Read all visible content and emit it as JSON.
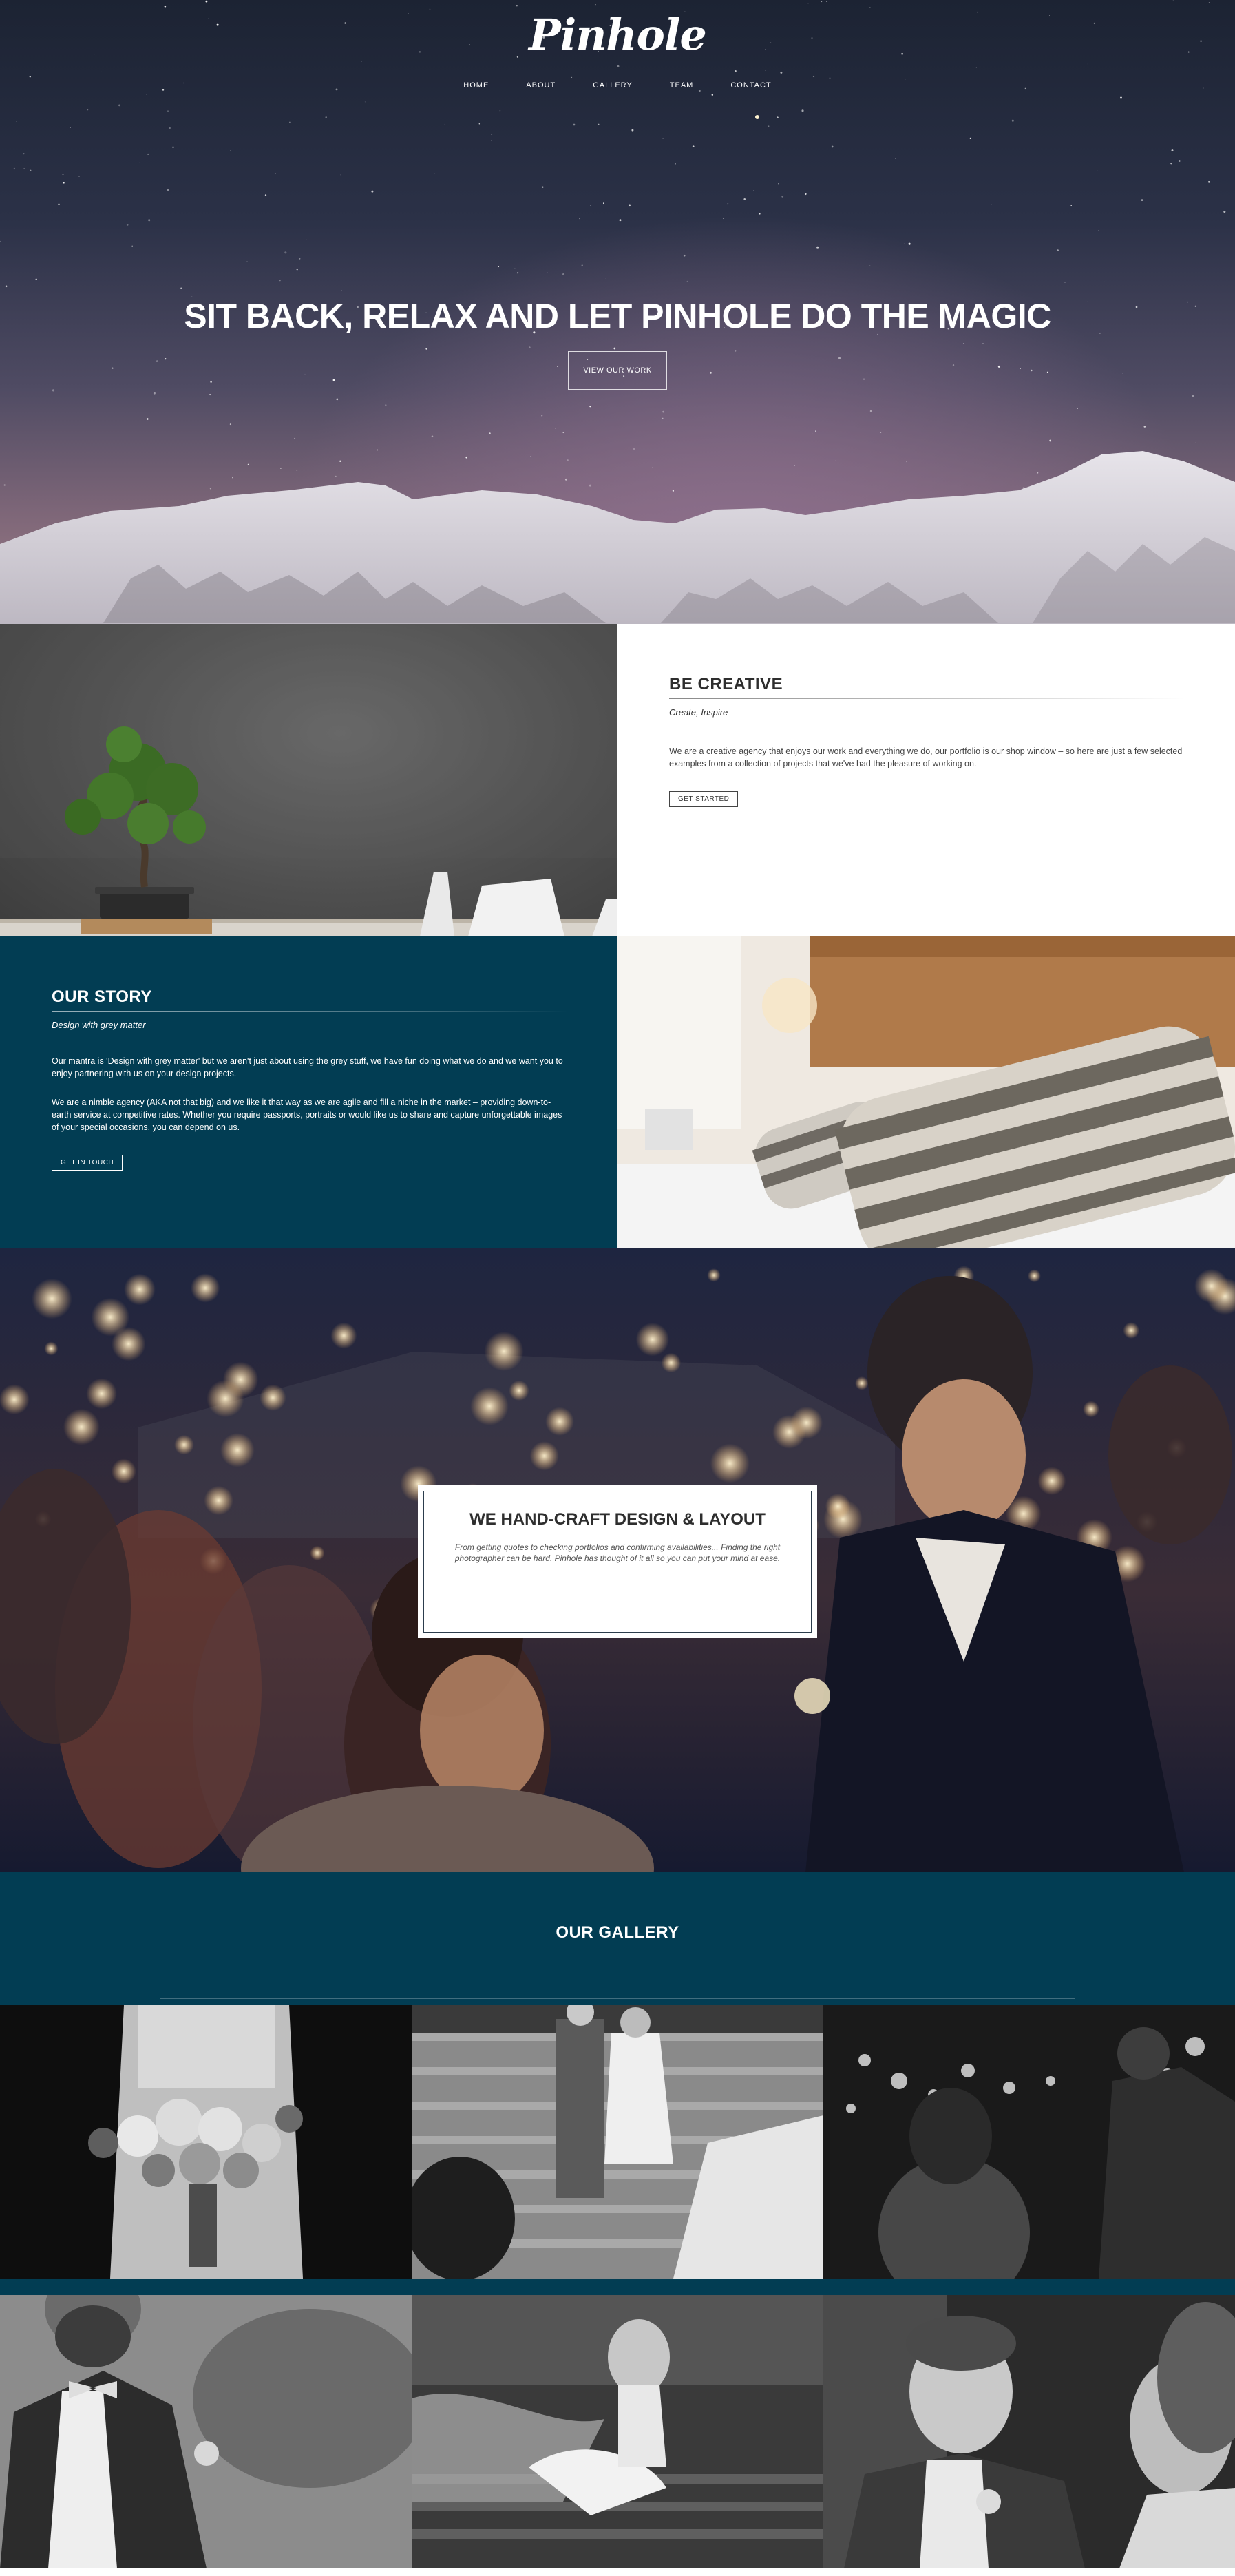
{
  "brand": {
    "logo": "Pinhole"
  },
  "nav": {
    "items": [
      "HOME",
      "ABOUT",
      "GALLERY",
      "TEAM",
      "CONTACT"
    ]
  },
  "hero": {
    "title": "SIT BACK, RELAX AND LET PINHOLE DO THE MAGIC",
    "button": "VIEW OUR WORK"
  },
  "creative": {
    "title": "BE CREATIVE",
    "subtitle": "Create, Inspire",
    "body": "We are a creative agency that enjoys our work and everything we do, our portfolio is our shop window – so here are just a few selected examples from a collection of projects that we've had the pleasure of working on.",
    "button": "GET STARTED"
  },
  "story": {
    "title": "OUR STORY",
    "subtitle": "Design with grey matter",
    "body1": "Our mantra is 'Design with grey matter' but we aren't just about using the grey stuff, we have fun doing what we do and we want you to enjoy partnering with us on your design projects.",
    "body2": "We are a nimble agency (AKA not that big) and we like it that way as we are agile and fill a niche in the market – providing down-to-earth service at competitive rates. Whether you require passports, portraits or would like us to share and capture unforgettable images of your special occasions, you can depend on us.",
    "button": "GET IN TOUCH"
  },
  "handcraft": {
    "title": "WE HAND-CRAFT DESIGN & LAYOUT",
    "body": "From getting quotes to checking portfolios and confirming availabilities... Finding the right photographer can be hard. Pinhole has thought of it all so you can put your mind at ease."
  },
  "gallery": {
    "title": "OUR GALLERY"
  },
  "colors": {
    "teal": "#023d53",
    "white": "#ffffff",
    "text": "#2e2e2e"
  }
}
